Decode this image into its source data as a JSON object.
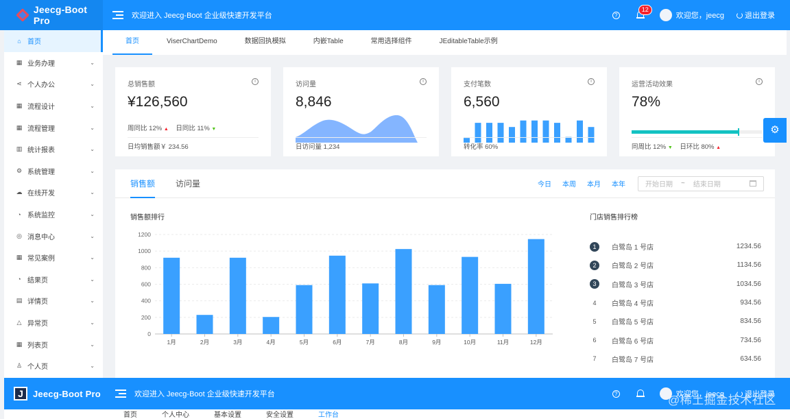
{
  "header": {
    "logo_text": "Jeecg-Boot Pro",
    "welcome": "欢迎进入 Jeecg-Boot 企业级快速开发平台",
    "notify_count": "12",
    "user_label": "欢迎您，jeecg",
    "logout": "退出登录"
  },
  "sidebar": {
    "items": [
      {
        "icon": "⌂",
        "label": "首页"
      },
      {
        "icon": "▦",
        "label": "业务办理"
      },
      {
        "icon": "⋖",
        "label": "个人办公"
      },
      {
        "icon": "▦",
        "label": "流程设计"
      },
      {
        "icon": "▦",
        "label": "流程管理"
      },
      {
        "icon": "▥",
        "label": "统计报表"
      },
      {
        "icon": "⚙",
        "label": "系统管理"
      },
      {
        "icon": "☁",
        "label": "在线开发"
      },
      {
        "icon": "◔",
        "label": "系统监控"
      },
      {
        "icon": "◎",
        "label": "消息中心"
      },
      {
        "icon": "▦",
        "label": "常见案例"
      },
      {
        "icon": "◔",
        "label": "结果页"
      },
      {
        "icon": "▤",
        "label": "详情页"
      },
      {
        "icon": "△",
        "label": "异常页"
      },
      {
        "icon": "▦",
        "label": "列表页"
      },
      {
        "icon": "♙",
        "label": "个人页"
      }
    ]
  },
  "tabs": [
    "首页",
    "ViserChartDemo",
    "数据回执模拟",
    "内嵌Table",
    "常用选择组件",
    "JEditableTable示例"
  ],
  "cards": {
    "sales": {
      "title": "总销售额",
      "value": "¥126,560",
      "wow_label": "周同比",
      "wow": "12%",
      "dod_label": "日同比",
      "dod": "11%",
      "foot": "日均销售额￥ 234.56"
    },
    "visits": {
      "title": "访问量",
      "value": "8,846",
      "foot": "日访问量 1,234"
    },
    "payments": {
      "title": "支付笔数",
      "value": "6,560",
      "foot": "转化率 60%",
      "bars": [
        0.18,
        0.76,
        0.76,
        0.76,
        0.6,
        0.85,
        0.85,
        0.85,
        0.76,
        0.22,
        0.85,
        0.6
      ]
    },
    "ops": {
      "title": "运营活动效果",
      "value": "78%",
      "progress": 0.82,
      "wow_label": "同周比",
      "wow": "12%",
      "dod_label": "日环比",
      "dod": "80%"
    }
  },
  "panel": {
    "tab_sales": "销售额",
    "tab_visits": "访问量",
    "links": [
      "今日",
      "本周",
      "本月",
      "本年"
    ],
    "start_placeholder": "开始日期",
    "separator": "~",
    "end_placeholder": "结束日期",
    "chart_title": "销售额排行",
    "rank_title": "门店销售排行榜"
  },
  "chart_data": {
    "type": "bar",
    "title": "销售额排行",
    "categories": [
      "1月",
      "2月",
      "3月",
      "4月",
      "5月",
      "6月",
      "7月",
      "8月",
      "9月",
      "10月",
      "11月",
      "12月"
    ],
    "values": [
      920,
      230,
      920,
      205,
      590,
      945,
      610,
      1025,
      590,
      930,
      605,
      1145
    ],
    "yticks": [
      0,
      200,
      400,
      600,
      800,
      1000,
      1200
    ],
    "ylim": [
      0,
      1200
    ],
    "color": "#3aa0ff"
  },
  "ranking": [
    {
      "no": "1",
      "name": "白鹭岛 1 号店",
      "value": "1234.56"
    },
    {
      "no": "2",
      "name": "白鹭岛 2 号店",
      "value": "1134.56"
    },
    {
      "no": "3",
      "name": "白鹭岛 3 号店",
      "value": "1034.56"
    },
    {
      "no": "4",
      "name": "白鹭岛 4 号店",
      "value": "934.56"
    },
    {
      "no": "5",
      "name": "白鹭岛 5 号店",
      "value": "834.56"
    },
    {
      "no": "6",
      "name": "白鹭岛 6 号店",
      "value": "734.56"
    },
    {
      "no": "7",
      "name": "白鹭岛 7 号店",
      "value": "634.56"
    }
  ],
  "header2": {
    "logo_mark": "J",
    "logo_text": "Jeecg-Boot Pro",
    "welcome": "欢迎进入 Jeecg-Boot 企业级快速开发平台",
    "user_label": "欢迎您，jeecg",
    "logout": "退出登录",
    "strip_items": [
      "首页",
      "个人中心",
      "基本设置",
      "安全设置",
      "工作台"
    ],
    "watermark": "@稀土掘金技术社区"
  }
}
